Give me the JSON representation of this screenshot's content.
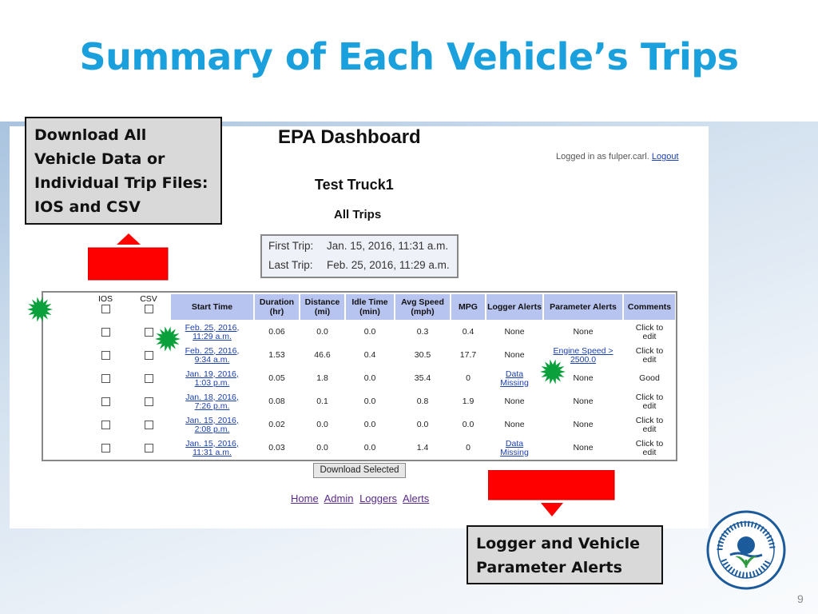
{
  "slide": {
    "title": "Summary of Each Vehicle’s Trips",
    "number": "9",
    "title_color": "#1aa0dc"
  },
  "dashboard": {
    "title": "EPA Dashboard",
    "logged_in_prefix": "Logged in as fulper.carl.",
    "logout_label": "Logout",
    "vehicle": "Test Truck1",
    "subtitle": "All Trips",
    "first_trip_label": "First Trip:",
    "first_trip_value": "Jan. 15, 2016, 11:31 a.m.",
    "last_trip_label": "Last Trip:",
    "last_trip_value": "Feb. 25, 2016, 11:29 a.m.",
    "download_button": "Download Selected",
    "nav": [
      "Home",
      "Admin",
      "Loggers",
      "Alerts"
    ]
  },
  "table": {
    "headers": {
      "ios": "IOS",
      "csv": "CSV",
      "start": "Start Time",
      "duration": [
        "Duration",
        "(hr)"
      ],
      "distance": [
        "Distance",
        "(mi)"
      ],
      "idle": [
        "Idle Time",
        "(min)"
      ],
      "speed": [
        "Avg Speed",
        "(mph)"
      ],
      "mpg": "MPG",
      "logger": "Logger Alerts",
      "param": "Parameter Alerts",
      "comments": "Comments"
    },
    "rows": [
      {
        "start": [
          "Feb. 25, 2016,",
          "11:29 a.m."
        ],
        "duration": "0.06",
        "distance": "0.0",
        "idle": "0.0",
        "speed": "0.3",
        "mpg": "0.4",
        "logger": [
          "None"
        ],
        "logger_link": false,
        "param": [
          "None"
        ],
        "param_link": false,
        "comments": [
          "Click to",
          "edit"
        ]
      },
      {
        "start": [
          "Feb. 25, 2016,",
          "9:34 a.m."
        ],
        "duration": "1.53",
        "distance": "46.6",
        "idle": "0.4",
        "speed": "30.5",
        "mpg": "17.7",
        "logger": [
          "None"
        ],
        "logger_link": false,
        "param": [
          "Engine Speed >",
          "2500.0"
        ],
        "param_link": true,
        "comments": [
          "Click to",
          "edit"
        ]
      },
      {
        "start": [
          "Jan. 19, 2016,",
          "1:03 p.m."
        ],
        "duration": "0.05",
        "distance": "1.8",
        "idle": "0.0",
        "speed": "35.4",
        "mpg": "0",
        "logger": [
          "Data",
          "Missing"
        ],
        "logger_link": true,
        "param": [
          "None"
        ],
        "param_link": false,
        "comments": [
          "Good"
        ]
      },
      {
        "start": [
          "Jan. 18, 2016,",
          "7:26 p.m."
        ],
        "duration": "0.08",
        "distance": "0.1",
        "idle": "0.0",
        "speed": "0.8",
        "mpg": "1.9",
        "logger": [
          "None"
        ],
        "logger_link": false,
        "param": [
          "None"
        ],
        "param_link": false,
        "comments": [
          "Click to",
          "edit"
        ]
      },
      {
        "start": [
          "Jan. 15, 2016,",
          "2:08 p.m."
        ],
        "duration": "0.02",
        "distance": "0.0",
        "idle": "0.0",
        "speed": "0.0",
        "mpg": "0.0",
        "logger": [
          "None"
        ],
        "logger_link": false,
        "param": [
          "None"
        ],
        "param_link": false,
        "comments": [
          "Click to",
          "edit"
        ]
      },
      {
        "start": [
          "Jan. 15, 2016,",
          "11:31 a.m."
        ],
        "duration": "0.03",
        "distance": "0.0",
        "idle": "0.0",
        "speed": "1.4",
        "mpg": "0",
        "logger": [
          "Data",
          "Missing"
        ],
        "logger_link": true,
        "param": [
          "None"
        ],
        "param_link": false,
        "comments": [
          "Click to",
          "edit"
        ]
      }
    ]
  },
  "callouts": {
    "download": [
      "Download All",
      "Vehicle Data or",
      "Individual Trip Files:",
      "IOS and CSV"
    ],
    "alerts": [
      "Logger and Vehicle",
      "Parameter Alerts"
    ]
  },
  "colors": {
    "header_bg": "#b8c4f0",
    "arrow_red": "#ff0000",
    "star_green": "#0aa03c",
    "link": "#1a3fb0"
  },
  "icons": [
    "up-arrow-icon",
    "down-arrow-icon",
    "star-burst-icon",
    "epa-seal-icon",
    "checkbox-icon"
  ]
}
